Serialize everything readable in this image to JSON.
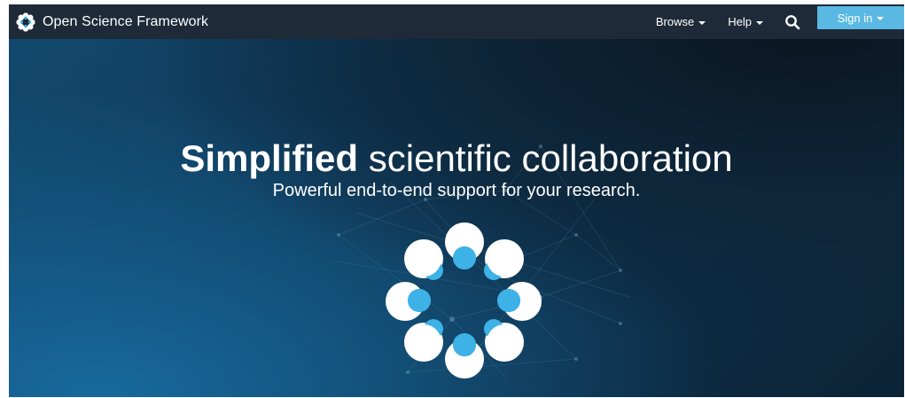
{
  "navbar": {
    "brand": "Open Science Framework",
    "links": {
      "browse": "Browse",
      "help": "Help"
    },
    "signin": "Sign in",
    "icons": [
      "osf-logo-icon",
      "chevron-down-icon",
      "search-icon"
    ]
  },
  "hero": {
    "headline_bold": "Simplified",
    "headline_rest": "scientific collaboration",
    "subheadline": "Powerful end-to-end support for your research."
  },
  "colors": {
    "navbar": "#1e2a38",
    "signin": "#5ab8e3",
    "accent_blue": "#3db2e6",
    "hero_dark": "#0c2336",
    "hero_light": "#176a9e"
  }
}
